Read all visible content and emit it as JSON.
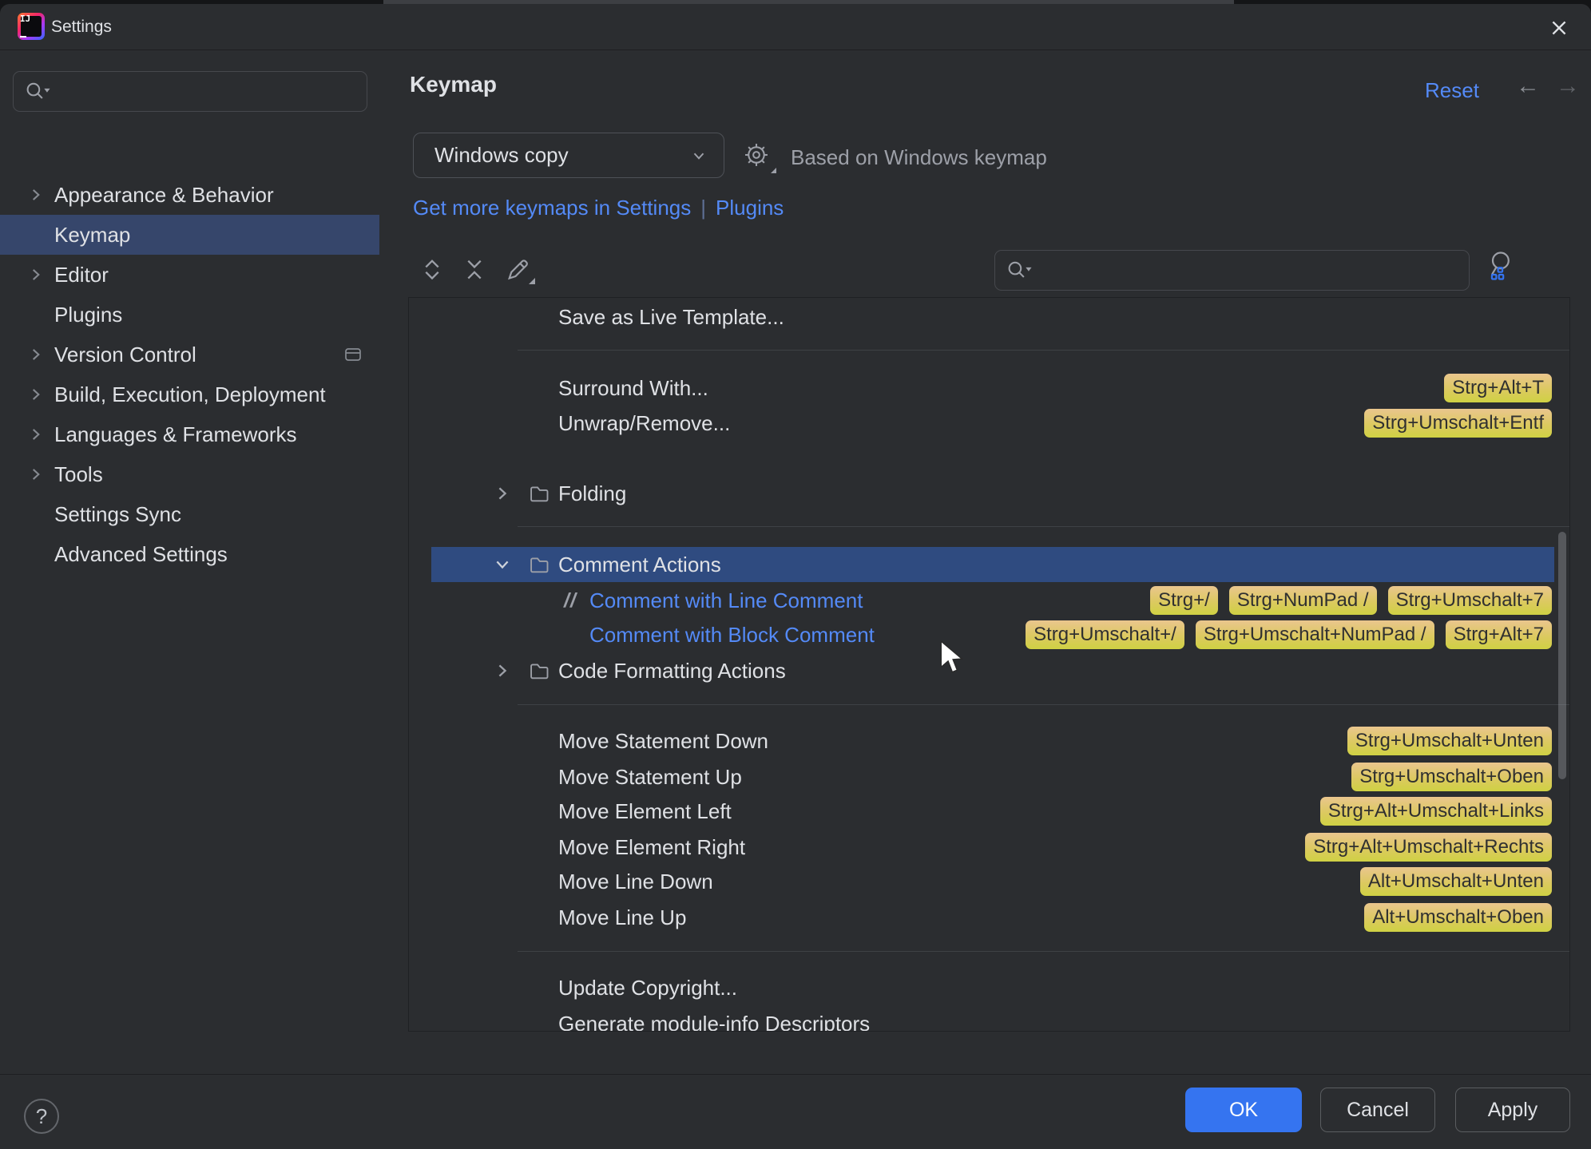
{
  "window": {
    "title": "Settings"
  },
  "sidebar": {
    "search_value": "",
    "items": [
      {
        "label": "Appearance & Behavior",
        "expandable": true,
        "selected": false
      },
      {
        "label": "Keymap",
        "expandable": false,
        "selected": true
      },
      {
        "label": "Editor",
        "expandable": true,
        "selected": false
      },
      {
        "label": "Plugins",
        "expandable": false,
        "selected": false
      },
      {
        "label": "Version Control",
        "expandable": true,
        "selected": false,
        "trailing_icon": "window-preview-icon"
      },
      {
        "label": "Build, Execution, Deployment",
        "expandable": true,
        "selected": false
      },
      {
        "label": "Languages & Frameworks",
        "expandable": true,
        "selected": false
      },
      {
        "label": "Tools",
        "expandable": true,
        "selected": false
      },
      {
        "label": "Settings Sync",
        "expandable": false,
        "selected": false
      },
      {
        "label": "Advanced Settings",
        "expandable": false,
        "selected": false
      }
    ]
  },
  "header": {
    "title": "Keymap",
    "reset_label": "Reset",
    "back_icon": "←",
    "forward_icon": "→"
  },
  "scheme_bar": {
    "selected_keymap": "Windows copy",
    "based_on": "Based on Windows keymap"
  },
  "links": {
    "more_keymaps": "Get more keymaps in Settings",
    "separator": "|",
    "plugins": "Plugins"
  },
  "list_toolbar": {
    "search_value": ""
  },
  "tree": {
    "entries": [
      {
        "kind": "action",
        "label": "Save as Live Template..."
      },
      {
        "kind": "sep"
      },
      {
        "kind": "action",
        "label": "Surround With...",
        "shortcuts": [
          "Strg+Alt+T"
        ]
      },
      {
        "kind": "action",
        "label": "Unwrap/Remove...",
        "shortcuts": [
          "Strg+Umschalt+Entf"
        ]
      },
      {
        "kind": "folder",
        "label": "Folding",
        "state": "collapsed"
      },
      {
        "kind": "sep"
      },
      {
        "kind": "folder",
        "label": "Comment Actions",
        "state": "expanded",
        "selected": true
      },
      {
        "kind": "subaction",
        "label": "Comment with Line Comment",
        "icon": "line-comment-icon",
        "shortcuts": [
          "Strg+/",
          "Strg+NumPad /",
          "Strg+Umschalt+7"
        ]
      },
      {
        "kind": "subaction",
        "label": "Comment with Block Comment",
        "shortcuts": [
          "Strg+Umschalt+/",
          "Strg+Umschalt+NumPad /",
          "Strg+Alt+7"
        ]
      },
      {
        "kind": "folder",
        "label": "Code Formatting Actions",
        "state": "collapsed"
      },
      {
        "kind": "sep"
      },
      {
        "kind": "action",
        "label": "Move Statement Down",
        "shortcuts": [
          "Strg+Umschalt+Unten"
        ]
      },
      {
        "kind": "action",
        "label": "Move Statement Up",
        "shortcuts": [
          "Strg+Umschalt+Oben"
        ]
      },
      {
        "kind": "action",
        "label": "Move Element Left",
        "shortcuts": [
          "Strg+Alt+Umschalt+Links"
        ]
      },
      {
        "kind": "action",
        "label": "Move Element Right",
        "shortcuts": [
          "Strg+Alt+Umschalt+Rechts"
        ]
      },
      {
        "kind": "action",
        "label": "Move Line Down",
        "shortcuts": [
          "Alt+Umschalt+Unten"
        ]
      },
      {
        "kind": "action",
        "label": "Move Line Up",
        "shortcuts": [
          "Alt+Umschalt+Oben"
        ]
      },
      {
        "kind": "sep"
      },
      {
        "kind": "action",
        "label": "Update Copyright..."
      },
      {
        "kind": "action",
        "label": "Generate module-info Descriptors"
      }
    ]
  },
  "footer": {
    "ok_label": "OK",
    "cancel_label": "Cancel",
    "apply_label": "Apply",
    "help_label": "?"
  },
  "colors": {
    "accent": "#3574F0",
    "link": "#548AF7",
    "sidebar_selection": "#36466B",
    "tree_selection": "#2F4B80",
    "badge_top": "#EAC68E",
    "badge_bottom": "#CFD143"
  }
}
